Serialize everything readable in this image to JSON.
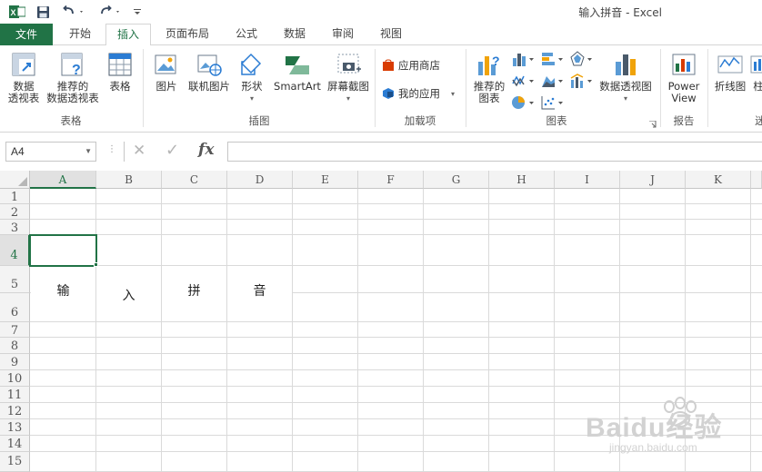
{
  "window": {
    "title": "输入拼音 - Excel"
  },
  "quick_access": {
    "save_icon": "save-icon",
    "undo_icon": "undo-icon",
    "redo_icon": "redo-icon",
    "customize_icon": "customize-qat-icon"
  },
  "tabs": [
    "文件",
    "开始",
    "插入",
    "页面布局",
    "公式",
    "数据",
    "审阅",
    "视图"
  ],
  "active_tab": "插入",
  "ribbon": {
    "tables": {
      "label": "表格",
      "pivot": [
        "数据",
        "透视表"
      ],
      "recommended_pivot": [
        "推荐的",
        "数据透视表"
      ],
      "table": "表格"
    },
    "illustrations": {
      "label": "插图",
      "pictures": "图片",
      "online_pictures": "联机图片",
      "shapes": "形状",
      "smartart": "SmartArt",
      "screenshot": "屏幕截图"
    },
    "addins": {
      "label": "加载项",
      "store": "应用商店",
      "my_apps": "我的应用"
    },
    "charts": {
      "label": "图表",
      "recommended": [
        "推荐的",
        "图表"
      ],
      "pivot_chart": "数据透视图"
    },
    "reports": {
      "label": "报告",
      "power_view": [
        "Power",
        "View"
      ]
    },
    "sparklines": {
      "label": "迷",
      "line": "折线图",
      "column": "柱"
    }
  },
  "formula_bar": {
    "name_box": "A4",
    "cancel_symbol": "✕",
    "enter_symbol": "✓",
    "fx_symbol": "fx",
    "formula": ""
  },
  "grid": {
    "columns": [
      "A",
      "B",
      "C",
      "D",
      "E",
      "F",
      "G",
      "H",
      "I",
      "J",
      "K"
    ],
    "selected_column": "A",
    "rows": [
      "1",
      "2",
      "3",
      "4",
      "5",
      "6",
      "7",
      "8",
      "9",
      "10",
      "11",
      "12",
      "13",
      "14",
      "15"
    ],
    "selected_row": "4",
    "active_cell": "A4",
    "cells": {
      "A5": "输",
      "B5": "入",
      "C5": "拼",
      "D5": "音"
    }
  },
  "watermark": {
    "text": "Baidu经验",
    "url": "jingyan.baidu.com"
  },
  "colors": {
    "excel_green": "#217346",
    "header_gray": "#f3f3f3",
    "gridline": "#dadada"
  }
}
